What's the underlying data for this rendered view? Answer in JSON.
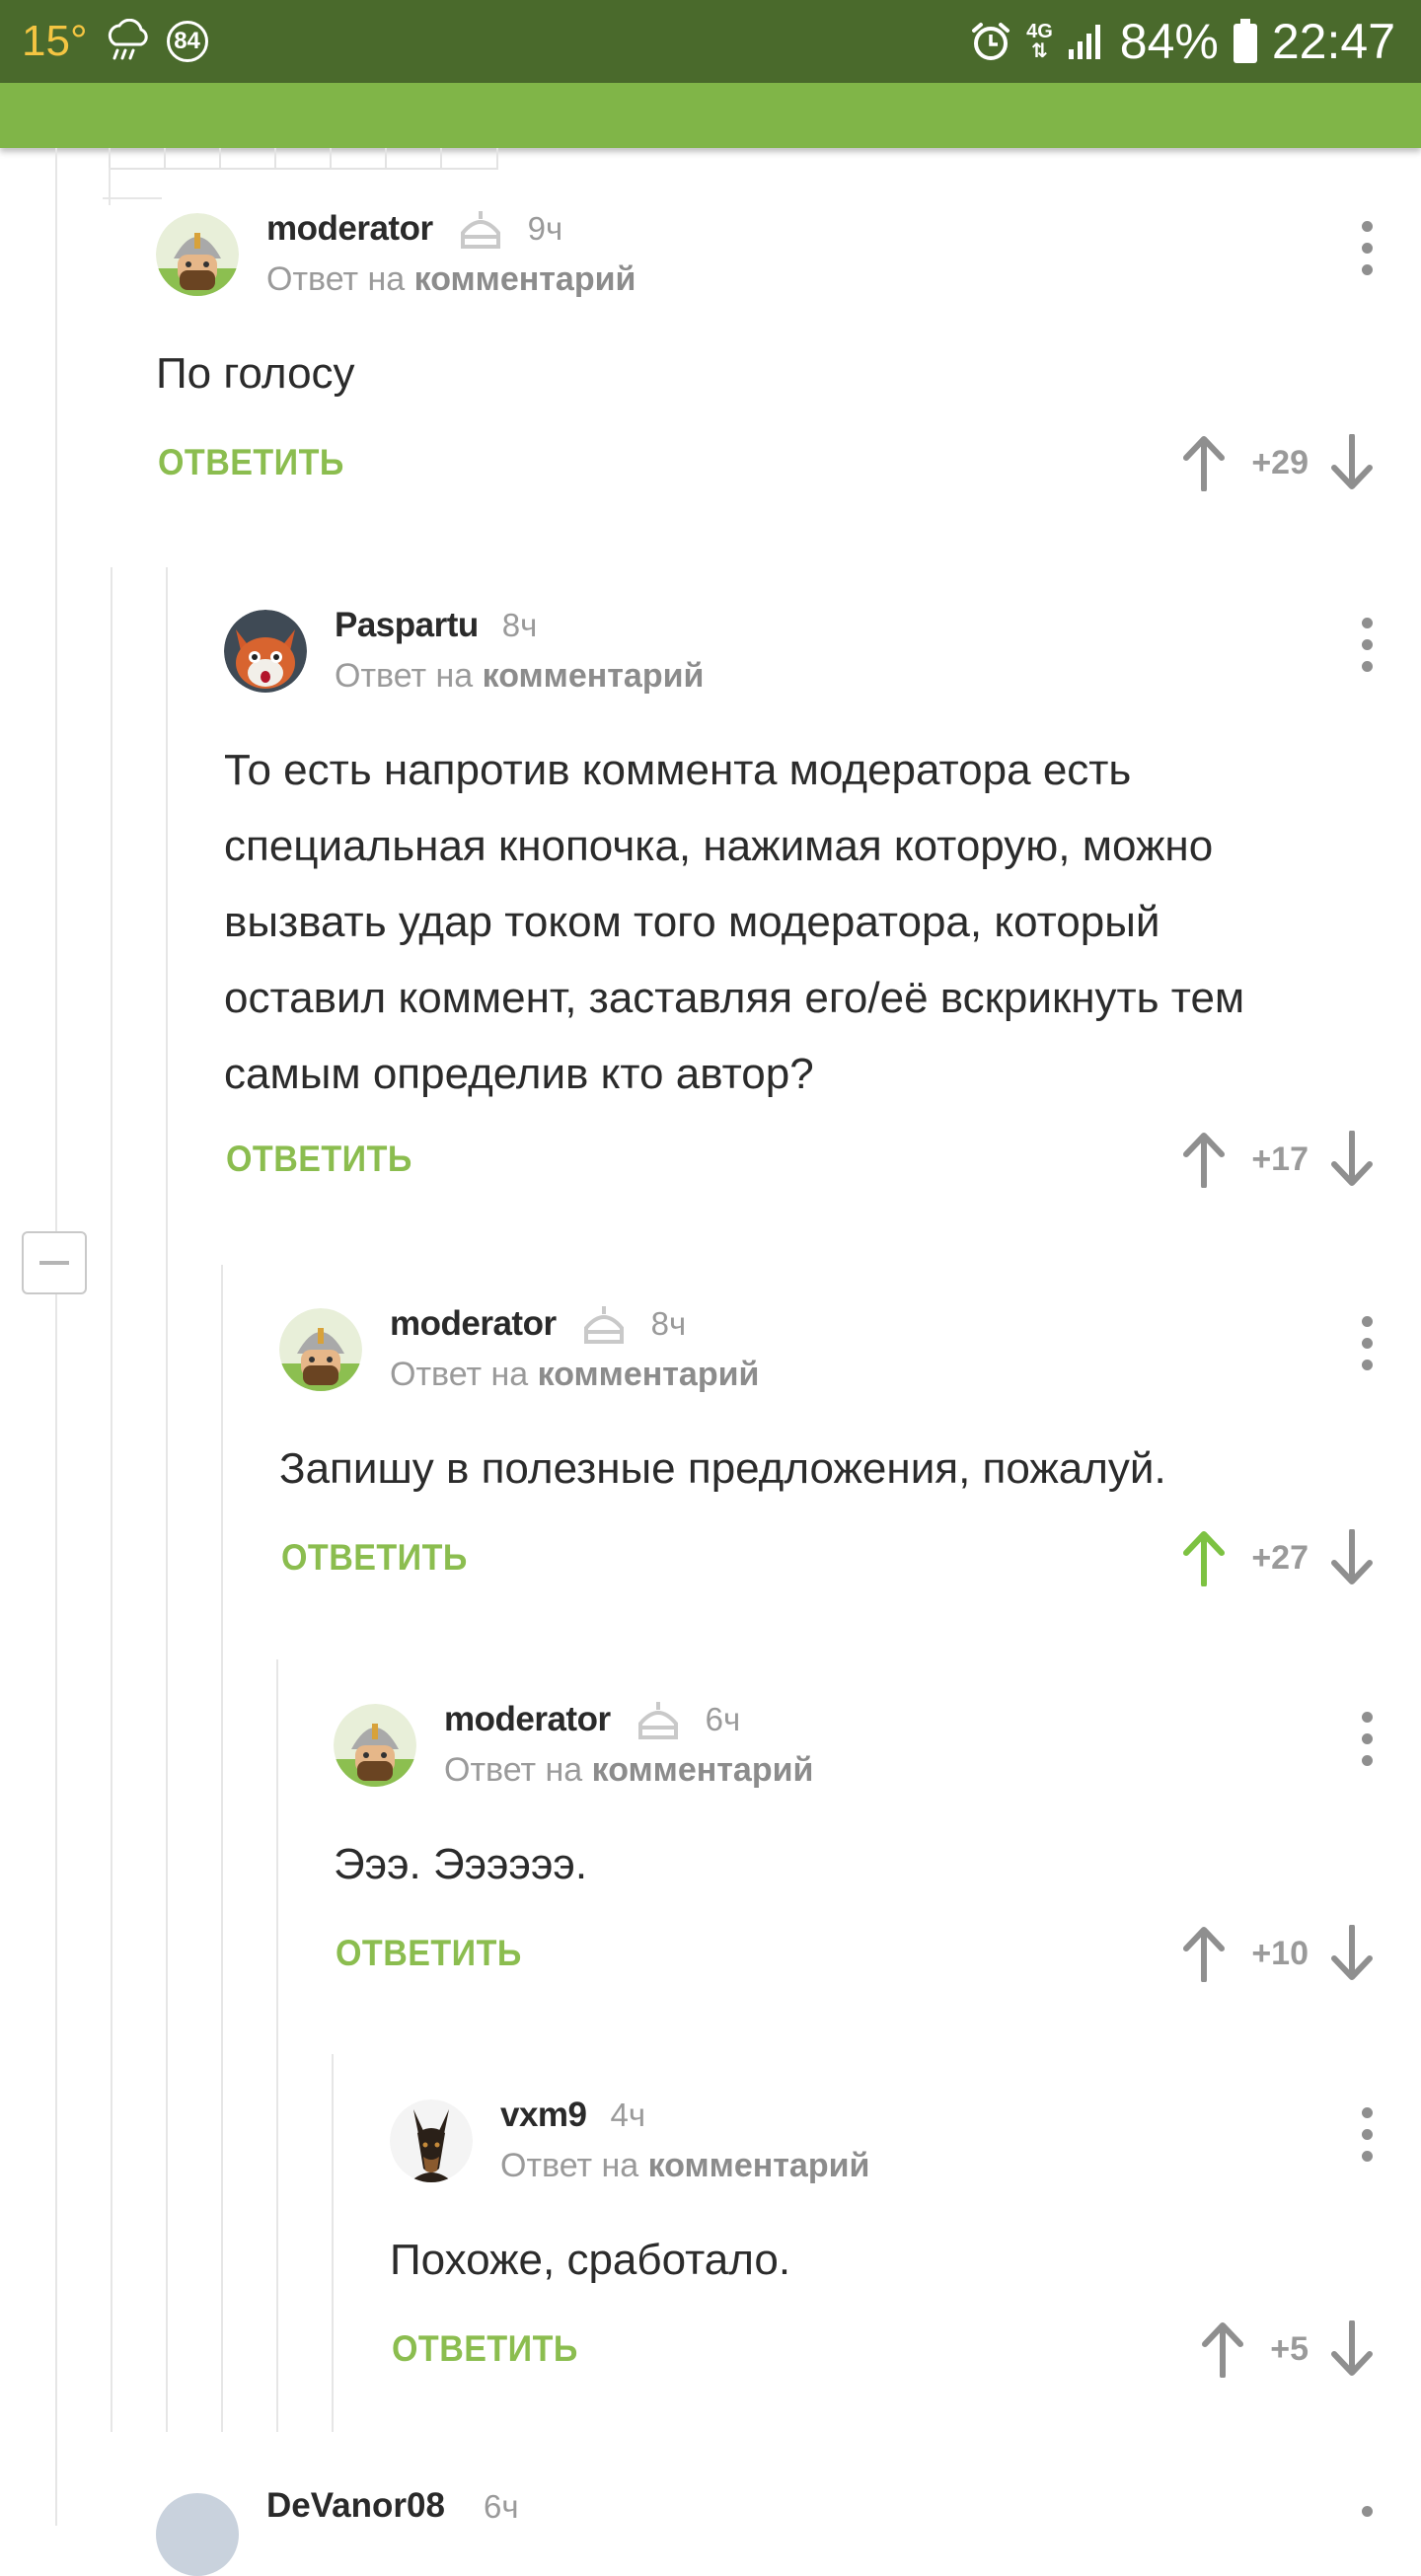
{
  "status_bar": {
    "temperature": "15°",
    "badge": "84",
    "network": "4G",
    "battery": "84%",
    "time": "22:47",
    "icons": [
      "weather-rain-icon",
      "badge-icon",
      "alarm-icon",
      "network-4g-icon",
      "signal-icon",
      "battery-icon"
    ]
  },
  "colors": {
    "status_bar": "#4a6a2c",
    "header": "#80b548",
    "accent": "#8bbd4f",
    "upvoted": "#7dc242",
    "text": "#2b2b2b",
    "muted": "#9a9a9a"
  },
  "labels": {
    "reply_to": "Ответ на",
    "reply_to_link": "комментарий",
    "reply_button": "ОТВЕТИТЬ"
  },
  "comments": [
    {
      "author": "moderator",
      "time": "9ч",
      "moderator_badge": true,
      "avatar": "moderator-avatar",
      "text": "По голосу",
      "rating": "+29",
      "upvoted": false
    },
    {
      "author": "Paspartu",
      "time": "8ч",
      "moderator_badge": false,
      "avatar": "paspartu-avatar",
      "text": "То есть напротив коммента модератора есть специальная кнопочка, нажимая которую, можно вызвать удар током того модератора, который оставил коммент, заставляя его/её вскрикнуть тем самым определив кто автор?",
      "rating": "+17",
      "upvoted": false
    },
    {
      "author": "moderator",
      "time": "8ч",
      "moderator_badge": true,
      "avatar": "moderator-avatar",
      "text": "Запишу в полезные предложения, пожалуй.",
      "rating": "+27",
      "upvoted": true
    },
    {
      "author": "moderator",
      "time": "6ч",
      "moderator_badge": true,
      "avatar": "moderator-avatar",
      "text": "Эээ. Ээээээ.",
      "rating": "+10",
      "upvoted": false
    },
    {
      "author": "vxm9",
      "time": "4ч",
      "moderator_badge": false,
      "avatar": "vxm9-avatar",
      "text": "Похоже, сработало.",
      "rating": "+5",
      "upvoted": false
    }
  ],
  "next_comment": {
    "author": "DeVanor08",
    "time": "6ч"
  }
}
